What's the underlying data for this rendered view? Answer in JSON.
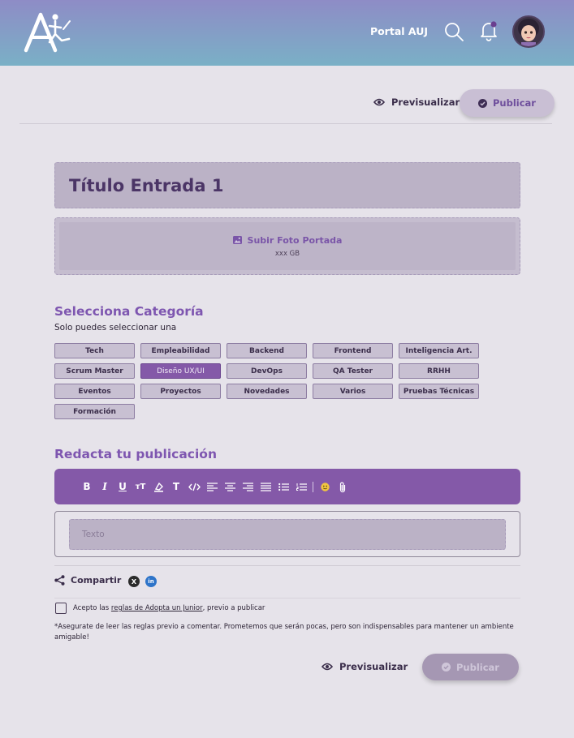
{
  "header": {
    "logo_text": "A",
    "portal_label": "Portal AUJ"
  },
  "actions": {
    "preview_label": "Previsualizar",
    "publish_label": "Publicar"
  },
  "post": {
    "title": "Título Entrada 1",
    "upload_label": "Subir Foto Portada",
    "upload_size": "xxx GB"
  },
  "categories": {
    "title": "Selecciona Categoría",
    "subtitle": "Solo puedes seleccionar una",
    "items": [
      {
        "label": "Tech"
      },
      {
        "label": "Empleabilidad"
      },
      {
        "label": "Backend"
      },
      {
        "label": "Frontend"
      },
      {
        "label": "Inteligencia Art."
      },
      {
        "label": "Scrum Master"
      },
      {
        "label": "Diseño UX/UI"
      },
      {
        "label": "DevOps"
      },
      {
        "label": "QA Tester"
      },
      {
        "label": "RRHH"
      },
      {
        "label": "Eventos"
      },
      {
        "label": "Proyectos"
      },
      {
        "label": "Novedades"
      },
      {
        "label": "Varios"
      },
      {
        "label": "Pruebas Técnicas"
      },
      {
        "label": "Formación"
      }
    ],
    "selected": "Diseño UX/UI"
  },
  "editor": {
    "title": "Redacta tu publicación",
    "placeholder": "Texto",
    "toolbar_icons": [
      "bold-icon",
      "italic-icon",
      "underline-icon",
      "text-size-icon",
      "highlight-icon",
      "text-color-icon",
      "code-icon",
      "align-left-icon",
      "align-center-icon",
      "align-right-icon",
      "justify-icon",
      "bullet-list-icon",
      "numbered-list-icon",
      "emoji-icon",
      "attach-icon"
    ],
    "toolbar_glyphs": {
      "bold": "B",
      "italic": "I",
      "underline": "U",
      "text_size": "тT",
      "text_color": "T"
    }
  },
  "share": {
    "label": "Compartir",
    "x_glyph": "X",
    "linkedin_glyph": "in"
  },
  "terms": {
    "prefix": "Acepto las ",
    "link": "reglas de Adopta un Junior",
    "suffix": ", previo a publicar",
    "note": "*Asegurate de leer las reglas previo a comentar. Prometemos que serán pocas, pero son indispensables para mantener un ambiente amigable!"
  },
  "colors": {
    "brand_purple": "#8459a8",
    "header_top": "#8e8cc6",
    "header_bottom": "#7ab0c6",
    "background": "#e6e3ea"
  }
}
